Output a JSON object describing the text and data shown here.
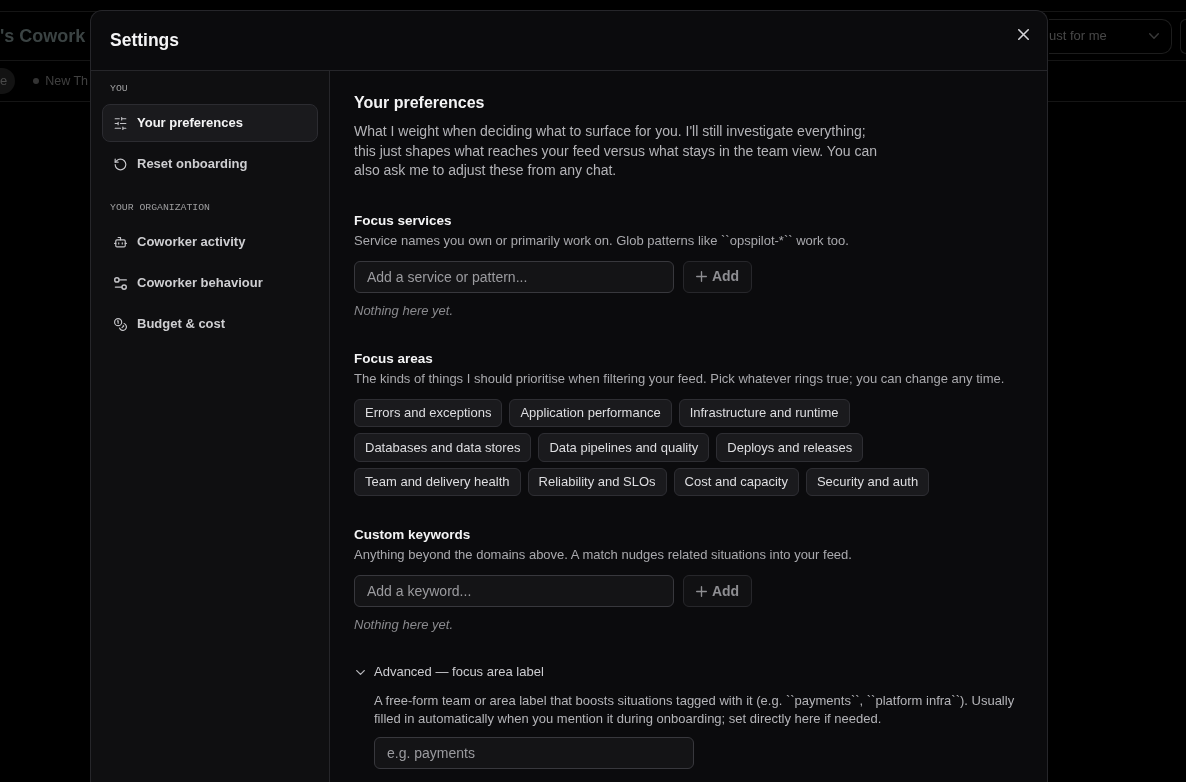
{
  "background": {
    "title": "'s Cowork",
    "tabs": [
      {
        "label": "e",
        "selected": true,
        "status_dot": false
      },
      {
        "label": "New Th",
        "selected": false,
        "status_dot": true
      }
    ],
    "scope_dropdown": {
      "value": "ust for me"
    }
  },
  "dialog": {
    "title": "Settings",
    "sidebar": {
      "groups": [
        {
          "heading": "YOU",
          "items": [
            {
              "label": "Your preferences",
              "selected": true
            },
            {
              "label": "Reset onboarding",
              "selected": false
            }
          ]
        },
        {
          "heading": "YOUR ORGANIZATION",
          "items": [
            {
              "label": "Coworker activity",
              "selected": false
            },
            {
              "label": "Coworker behaviour",
              "selected": false
            },
            {
              "label": "Budget & cost",
              "selected": false
            }
          ]
        }
      ]
    },
    "content": {
      "title": "Your preferences",
      "intro": "What I weight when deciding what to surface for you. I'll still investigate everything; this just shapes what reaches your feed versus what stays in the team view. You can also ask me to adjust these from any chat.",
      "sections": [
        {
          "kind": "list_input",
          "title": "Focus services",
          "description": "Service names you own or primarily work on. Glob patterns like ``opspilot-*`` work too.",
          "input": {
            "placeholder": "Add a service or pattern..."
          },
          "add_button": "Add",
          "empty_text": "Nothing here yet."
        },
        {
          "kind": "chips",
          "title": "Focus areas",
          "description": "The kinds of things I should prioritise when filtering your feed. Pick whatever rings true; you can change any time.",
          "options": [
            {
              "label": "Errors and exceptions",
              "selected": false
            },
            {
              "label": "Application performance",
              "selected": false
            },
            {
              "label": "Infrastructure and runtime",
              "selected": false
            },
            {
              "label": "Databases and data stores",
              "selected": false
            },
            {
              "label": "Data pipelines and quality",
              "selected": false
            },
            {
              "label": "Deploys and releases",
              "selected": false
            },
            {
              "label": "Team and delivery health",
              "selected": false
            },
            {
              "label": "Reliability and SLOs",
              "selected": false
            },
            {
              "label": "Cost and capacity",
              "selected": false
            },
            {
              "label": "Security and auth",
              "selected": false
            }
          ]
        },
        {
          "kind": "list_input",
          "title": "Custom keywords",
          "description": "Anything beyond the domains above. A match nudges related situations into your feed.",
          "input": {
            "placeholder": "Add a keyword..."
          },
          "add_button": "Add",
          "empty_text": "Nothing here yet."
        },
        {
          "kind": "collapsible",
          "title": "Advanced — focus area label",
          "expanded": true,
          "description": "A free-form team or area label that boosts situations tagged with it (e.g. ``payments``, ``platform infra``). Usually filled in automatically when you mention it during onboarding; set directly here if needed.",
          "input": {
            "placeholder": "e.g. payments"
          }
        }
      ]
    }
  }
}
